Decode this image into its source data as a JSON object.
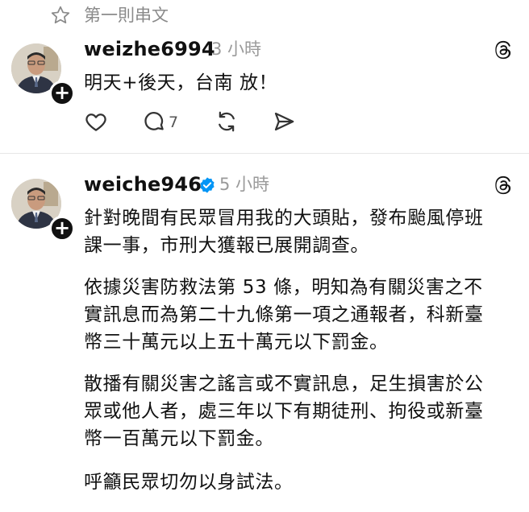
{
  "header": {
    "label": "第一則串文"
  },
  "post1": {
    "username": "weizhe6994",
    "time": "3 小時",
    "text": "明天+後天，台南 放！",
    "reply_count": "7"
  },
  "post2": {
    "username": "weiche946",
    "time": "5 小時",
    "paragraphs": [
      [
        "針對晚間有民眾冒用我的大頭貼，發布颱風停班",
        "課一事，市刑大獲報已展開調查。"
      ],
      [
        "依據災害防救法第 53 條，明知為有關災害之不",
        "實訊息而為第二十九條第一項之通報者，科新臺",
        "幣三十萬元以上五十萬元以下罰金。"
      ],
      [
        "散播有關災害之謠言或不實訊息，足生損害於公",
        "眾或他人者，處三年以下有期徒刑、拘役或新臺",
        "幣一百萬元以下罰金。"
      ],
      [
        "呼籲民眾切勿以身試法。"
      ]
    ]
  },
  "icons": {
    "header": "star-icon",
    "threads": "threads-logo-icon",
    "like": "heart-icon",
    "reply": "comment-icon",
    "repost": "repost-icon",
    "share": "send-icon",
    "verified": "verified-badge-icon",
    "follow": "plus-icon"
  },
  "colors": {
    "verified": "#0095f6",
    "muted": "#9a9a9a",
    "text": "#111111"
  }
}
